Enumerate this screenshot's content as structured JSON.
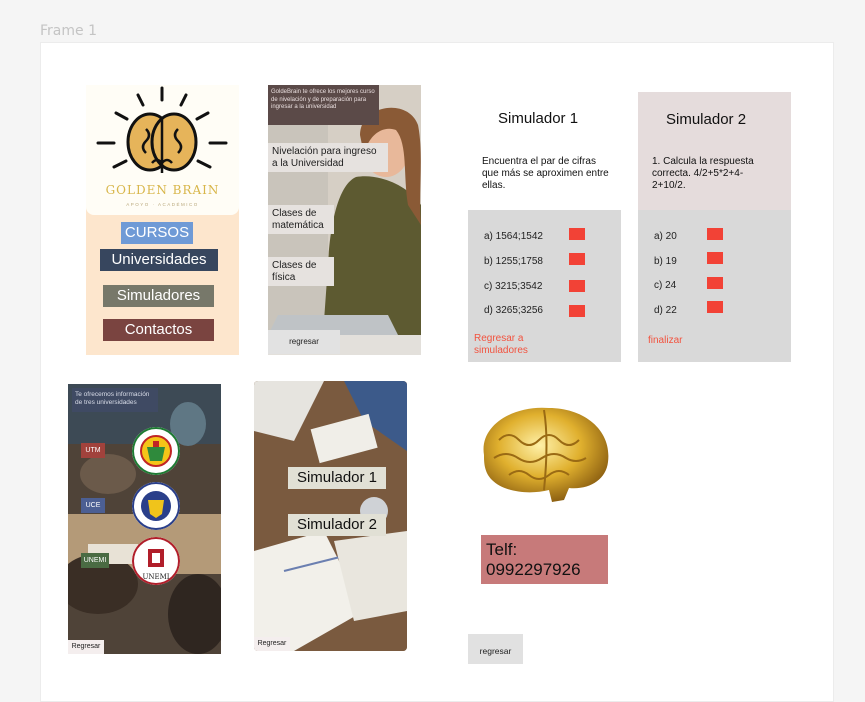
{
  "canvas": {
    "frame_label": "Frame 1"
  },
  "home": {
    "brand": "GOLDEN BRAIN",
    "brand_sub": "APOYO · ACADÉMICO",
    "menu": [
      "CURSOS",
      "Universidades",
      "Simuladores",
      "Contactos"
    ],
    "colors": {
      "bg": "#fde6cd",
      "cursos": "#6f9ad6",
      "universidades": "#37465e",
      "simuladores": "#77786a",
      "contactos": "#7a4440"
    }
  },
  "nivelacion": {
    "info": "GoldeBrain te ofrece los mejores curso de nivelación y de preparación para ingresar a la universidad",
    "tags": [
      "Nivelación para ingreso a la Universidad",
      "Clases de matemática",
      "Clases de física"
    ],
    "back": "regresar"
  },
  "simulador1": {
    "title": "Simulador 1",
    "question": "Encuentra el par de cifras que más se aproximen entre ellas.",
    "options": [
      "a) 1564;1542",
      "b) 1255;1758",
      "c) 3215;3542",
      "d) 3265;3256"
    ],
    "link": "Regresar a simuladores"
  },
  "simulador2": {
    "title": "Simulador 2",
    "question": "1. Calcula la respuesta correcta. 4/2+5*2+4-2+10/2.",
    "options": [
      "a) 20",
      "b) 19",
      "c) 24",
      "d) 22"
    ],
    "link": "finalizar"
  },
  "universidades": {
    "info": "Te ofrecemos información de tres universidades",
    "tags": [
      {
        "label": "UTM",
        "color": "#a1423c"
      },
      {
        "label": "UCE",
        "color": "#4c5f93"
      },
      {
        "label": "UNEMI",
        "color": "#4a6b43"
      }
    ],
    "seal_words": [
      "UNEMI"
    ],
    "back": "Regresar"
  },
  "simuladores": {
    "buttons": [
      "Simulador 1",
      "Simulador 2"
    ],
    "back": "Regresar"
  },
  "contacto": {
    "label": "Telf:",
    "phone": "0992297926",
    "back": "regresar"
  }
}
